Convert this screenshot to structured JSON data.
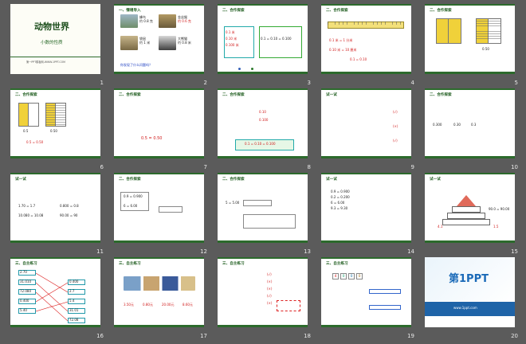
{
  "slides": [
    {
      "num": "1",
      "title": "动物世界",
      "subtitle": "小数的性质",
      "footer": "第一PPT模板网-WWW.1PPT.COM"
    },
    {
      "num": "2",
      "heading": "一、情境导入",
      "texts": [
        "蜂鸟",
        "约 0.8 克",
        "金丝猴",
        "约 0.6 克",
        "袋鼠",
        "约 1 米",
        "大熊猫",
        "约 0.8 米"
      ],
      "question": "你发现了什么问题吗？"
    },
    {
      "num": "3",
      "heading": "二、合作探索",
      "texts": [
        "0.1 米",
        "0.10 米",
        "0.100 米",
        "0.1 = 0.10 = 0.100"
      ]
    },
    {
      "num": "4",
      "heading": "二、合作探索",
      "texts": [
        "0.1 米 = 1 分米",
        "0.10 米 = 10 厘米",
        "0.1 = 0.10"
      ]
    },
    {
      "num": "5",
      "heading": "二、合作探索",
      "texts": [
        "0.50"
      ]
    },
    {
      "num": "6",
      "heading": "二、合作探索",
      "texts": [
        "0.5",
        "0.50",
        "0.5 = 0.50"
      ]
    },
    {
      "num": "7",
      "heading": "二、合作探索",
      "texts": [
        "0.5 = 0.50"
      ]
    },
    {
      "num": "8",
      "heading": "二、合作探索",
      "texts": [
        "0.10",
        "0.100",
        "0.1 = 0.10 = 0.100"
      ]
    },
    {
      "num": "9",
      "heading": "试一试",
      "texts": [
        "(√)",
        "(×)",
        "(√)"
      ]
    },
    {
      "num": "10",
      "heading": "二、合作探索",
      "texts": [
        "0.300",
        "0.30",
        "0.3"
      ]
    },
    {
      "num": "11",
      "heading": "试一试",
      "texts": [
        "1.70 = 1.7",
        "0.800 = 0.8",
        "10.080 = 10.08",
        "90.00 = 90"
      ]
    },
    {
      "num": "12",
      "heading": "二、合作探索",
      "texts": [
        "0.9 = 0.900",
        "6 = 6.00"
      ]
    },
    {
      "num": "13",
      "heading": "二、合作探索",
      "texts": [
        "5 = 5.00"
      ]
    },
    {
      "num": "14",
      "heading": "试一试",
      "texts": [
        "0.9 = 0.900",
        "0.2 = 0.200",
        "6 = 6.00",
        "9.3 = 9.30"
      ]
    },
    {
      "num": "15",
      "heading": "试一试",
      "texts": [
        "90.0 = 90.00",
        "4.1",
        "1.5"
      ]
    },
    {
      "num": "16",
      "heading": "三、自主练习",
      "texts": [
        "2.70",
        "31.010",
        "72.080",
        "0.400",
        "5.40",
        "0.400",
        "2.7",
        "5.4",
        "31.01",
        "72.08"
      ]
    },
    {
      "num": "17",
      "heading": "三、自主练习",
      "texts": [
        "3.50元",
        "0.80元",
        "20.00元",
        "8.60元"
      ]
    },
    {
      "num": "18",
      "heading": "三、自主练习",
      "texts": [
        "(√)",
        "(×)",
        "(×)",
        "(√)",
        "(×)"
      ]
    },
    {
      "num": "19",
      "heading": "三、自主练习",
      "texts": [
        "4",
        "0",
        "0",
        "0"
      ]
    },
    {
      "num": "20",
      "logo": "第1PPT",
      "tagline": "www.1ppt.com"
    }
  ]
}
